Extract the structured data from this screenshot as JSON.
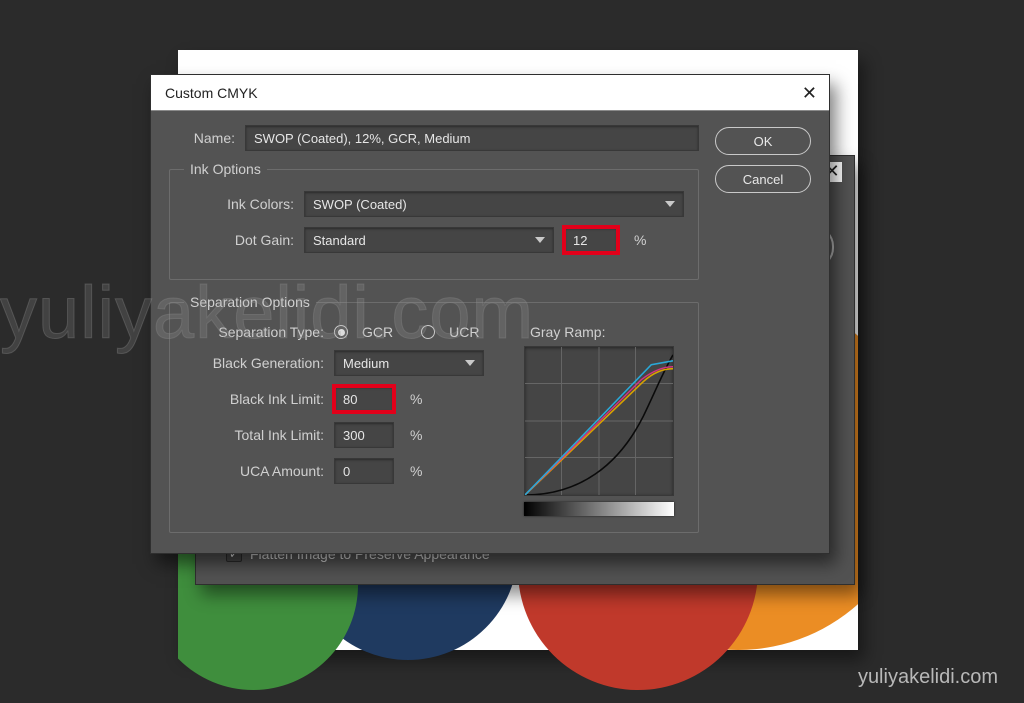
{
  "dialog": {
    "title": "Custom CMYK",
    "name_label": "Name:",
    "name_value": "SWOP (Coated), 12%, GCR, Medium",
    "ok_label": "OK",
    "cancel_label": "Cancel"
  },
  "ink": {
    "legend": "Ink Options",
    "colors_label": "Ink Colors:",
    "colors_value": "SWOP (Coated)",
    "dotgain_label": "Dot Gain:",
    "dotgain_value": "Standard",
    "dotgain_pct": "12",
    "pct_sign": "%"
  },
  "sep": {
    "legend": "Separation Options",
    "type_label": "Separation Type:",
    "gcr": "GCR",
    "ucr": "UCR",
    "blackgen_label": "Black Generation:",
    "blackgen_value": "Medium",
    "blackink_label": "Black Ink Limit:",
    "blackink_value": "80",
    "totalink_label": "Total Ink Limit:",
    "totalink_value": "300",
    "uca_label": "UCA Amount:",
    "uca_value": "0",
    "ramp_label": "Gray Ramp:",
    "pct_sign": "%"
  },
  "back_dialog": {
    "flatten_label": "Flatten Image to Preserve Appearance"
  },
  "watermark": {
    "big": "yuliyakelidi.com",
    "small": "yuliyakelidi.com"
  }
}
